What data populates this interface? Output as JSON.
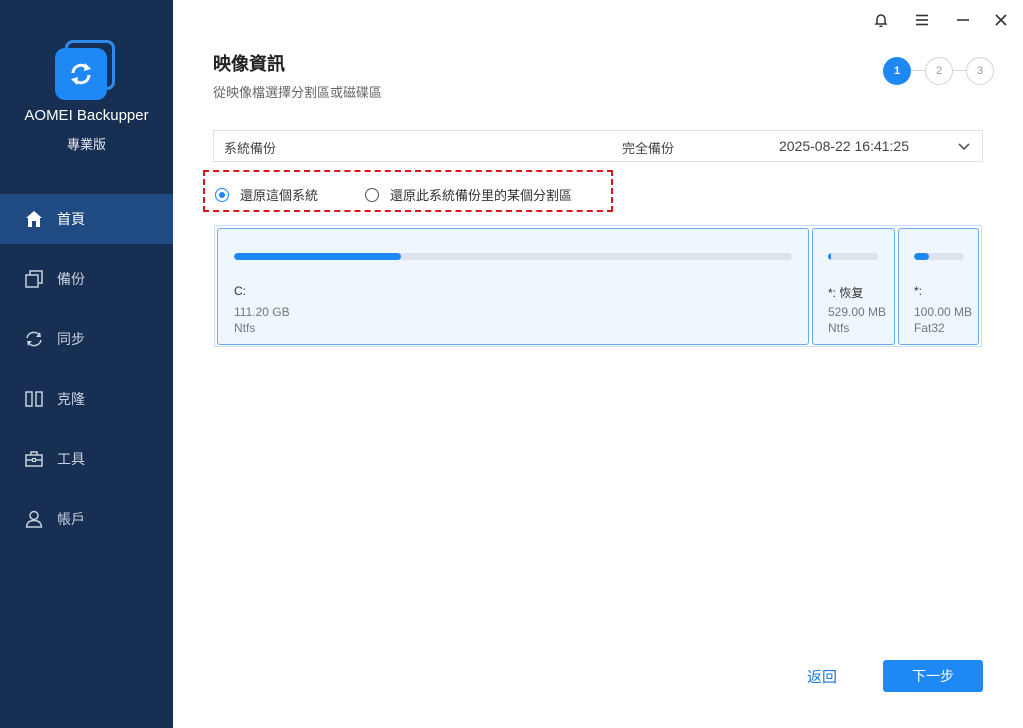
{
  "app": {
    "name": "AOMEI Backupper",
    "edition": "專業版"
  },
  "sidebar": {
    "items": [
      {
        "label": "首頁",
        "icon": "home-icon",
        "active": true
      },
      {
        "label": "備份",
        "icon": "backup-icon",
        "active": false
      },
      {
        "label": "同步",
        "icon": "sync-icon",
        "active": false
      },
      {
        "label": "克隆",
        "icon": "clone-icon",
        "active": false
      },
      {
        "label": "工具",
        "icon": "tools-icon",
        "active": false
      },
      {
        "label": "帳戶",
        "icon": "account-icon",
        "active": false
      }
    ]
  },
  "window_controls": {
    "icons": [
      "bell-icon",
      "menu-icon",
      "minimize-icon",
      "close-icon"
    ]
  },
  "header": {
    "title": "映像資訊",
    "subtitle": "從映像檔選擇分割區或磁碟區"
  },
  "steps": {
    "items": [
      "1",
      "2",
      "3"
    ],
    "current": 1
  },
  "backup_selector": {
    "name": "系統備份",
    "type": "完全備份",
    "date": "2025-08-22 16:41:25"
  },
  "restore_options": {
    "option1": "還原這個系統",
    "option2": "還原此系統備份里的某個分割區",
    "selected": 1
  },
  "partitions": [
    {
      "label": "C:",
      "size": "111.20 GB",
      "fs": "Ntfs",
      "used_fraction": 0.3
    },
    {
      "label": "*: 恢复",
      "size": "529.00 MB",
      "fs": "Ntfs",
      "used_fraction": 0.06
    },
    {
      "label": "*:",
      "size": "100.00 MB",
      "fs": "Fat32",
      "used_fraction": 0.3
    }
  ],
  "footer": {
    "back_label": "返回",
    "next_label": "下一步"
  },
  "colors": {
    "sidebar_bg": "#172f53",
    "sidebar_active": "#1f4a82",
    "accent": "#1e88f5",
    "highlight_border": "#d9161c"
  }
}
